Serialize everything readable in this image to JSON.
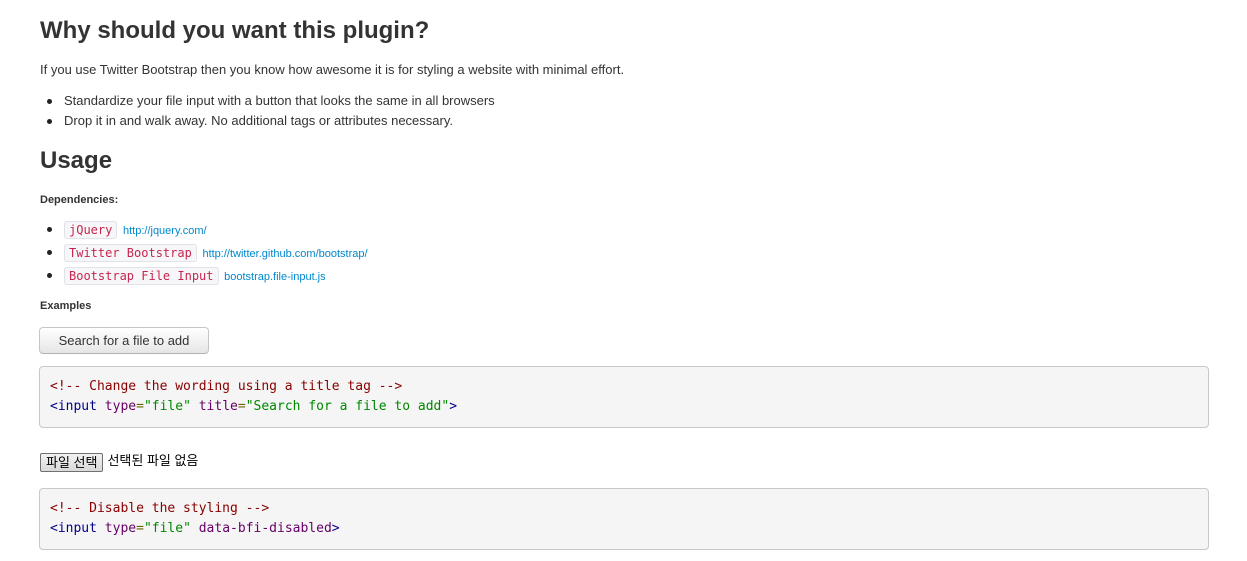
{
  "sections": {
    "why_title": "Why should you want this plugin?",
    "intro": "If you use Twitter Bootstrap then you know how awesome it is for styling a website with minimal effort.",
    "features": [
      "Standardize your file input with a button that looks the same in all browsers",
      "Drop it in and walk away. No additional tags or attributes necessary."
    ],
    "usage_title": "Usage",
    "dependencies_heading": "Dependencies:",
    "dependencies": [
      {
        "name": "jQuery",
        "link": "http://jquery.com/"
      },
      {
        "name": "Twitter Bootstrap",
        "link": "http://twitter.github.com/bootstrap/"
      },
      {
        "name": "Bootstrap File Input",
        "link": "bootstrap.file-input.js"
      }
    ],
    "examples_heading": "Examples"
  },
  "example1": {
    "button_label": "Search for a file to add",
    "code_comment": "<!-- Change the wording using a title tag -->",
    "code_tag_open": "<input",
    "attr1": "type",
    "val1": "\"file\"",
    "attr2": "title",
    "val2": "\"Search for a file to add\"",
    "code_tag_close": ">"
  },
  "example2": {
    "native_button_label": "파일 선택",
    "native_status": "선택된 파일 없음",
    "code_comment": "<!-- Disable the styling -->",
    "code_tag_open": "<input",
    "attr1": "type",
    "val1": "\"file\"",
    "attr2": "data-bfi-disabled",
    "code_tag_close": ">"
  },
  "colors": {
    "code_comment": "#880000",
    "code_tag": "#000088",
    "code_attr": "#660066",
    "code_string": "#008800",
    "link": "#0088cc",
    "inline_code": "#c7254e"
  }
}
